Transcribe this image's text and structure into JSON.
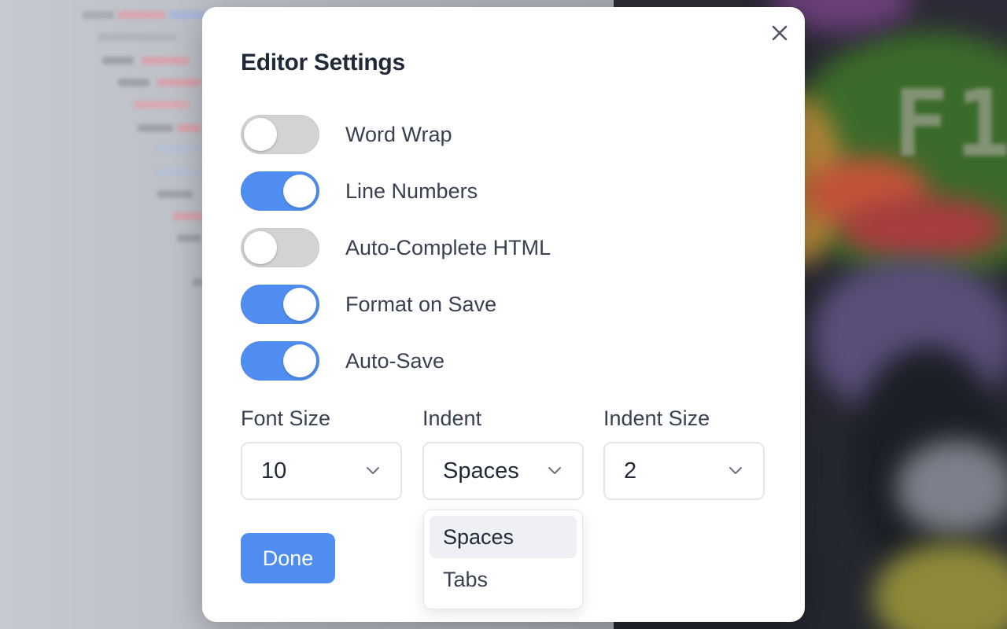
{
  "dialog": {
    "title": "Editor Settings",
    "close_icon": "close-icon"
  },
  "toggles": [
    {
      "label": "Word Wrap",
      "enabled": false
    },
    {
      "label": "Line Numbers",
      "enabled": true
    },
    {
      "label": "Auto-Complete HTML",
      "enabled": false
    },
    {
      "label": "Format on Save",
      "enabled": true
    },
    {
      "label": "Auto-Save",
      "enabled": true
    }
  ],
  "selects": {
    "font_size": {
      "label": "Font Size",
      "value": "10"
    },
    "indent": {
      "label": "Indent",
      "value": "Spaces",
      "open": true,
      "options": [
        "Spaces",
        "Tabs"
      ],
      "highlighted": "Spaces"
    },
    "indent_size": {
      "label": "Indent Size",
      "value": "2"
    }
  },
  "actions": {
    "done_label": "Done"
  },
  "background": {
    "overlay_text": "F1"
  },
  "colors": {
    "accent": "#4f8ef0",
    "toggle_off": "#d3d3d3",
    "title_text": "#1f2937",
    "label_text": "#374151"
  }
}
